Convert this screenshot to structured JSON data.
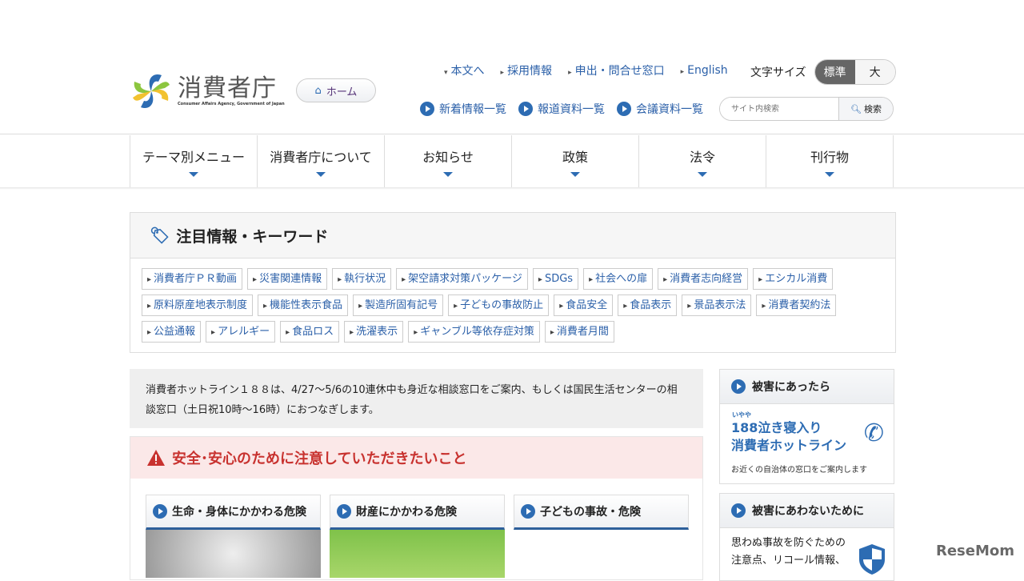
{
  "header": {
    "logo_jp": "消費者庁",
    "logo_en": "Consumer Affairs Agency, Government of Japan",
    "home": "ホーム",
    "top_links": [
      "本文へ",
      "採用情報",
      "申出・問合せ窓口",
      "English"
    ],
    "font_size_label": "文字サイズ",
    "font_std": "標準",
    "font_large": "大",
    "sub_links": [
      "新着情報一覧",
      "報道資料一覧",
      "会議資料一覧"
    ],
    "search_placeholder": "サイト内検索",
    "search_button": "検索"
  },
  "nav": [
    "テーマ別メニュー",
    "消費者庁について",
    "お知らせ",
    "政策",
    "法令",
    "刊行物"
  ],
  "keywords": {
    "title": "注目情報・キーワード",
    "tags": [
      "消費者庁ＰＲ動画",
      "災害関連情報",
      "執行状況",
      "架空請求対策パッケージ",
      "SDGs",
      "社会への扉",
      "消費者志向経営",
      "エシカル消費",
      "原料原産地表示制度",
      "機能性表示食品",
      "製造所固有記号",
      "子どもの事故防止",
      "食品安全",
      "食品表示",
      "景品表示法",
      "消費者契約法",
      "公益通報",
      "アレルギー",
      "食品ロス",
      "洗濯表示",
      "ギャンブル等依存症対策",
      "消費者月間"
    ]
  },
  "notice": "消費者ホットライン１８８は、4/27〜5/6の10連休中も身近な相談窓口をご案内、もしくは国民生活センターの相談窓口（土日祝10時〜16時）におつなぎします。",
  "safety": {
    "title": "安全･安心のために注意していただきたいこと",
    "cards": [
      "生命・身体にかかわる危険",
      "財産にかかわる危険",
      "子どもの事故・危険"
    ]
  },
  "side": {
    "box1_title": "被害にあったら",
    "ruby": "いやや",
    "hot1": "188泣き寝入り",
    "hot2": "消費者ホットライン",
    "hot_sub": "お近くの自治体の窓口をご案内します",
    "box2_title": "被害にあわないために",
    "box2_line1": "思わぬ事故を防ぐための",
    "box2_line2": "注意点、リコール情報、"
  },
  "watermark": "ReseMom"
}
